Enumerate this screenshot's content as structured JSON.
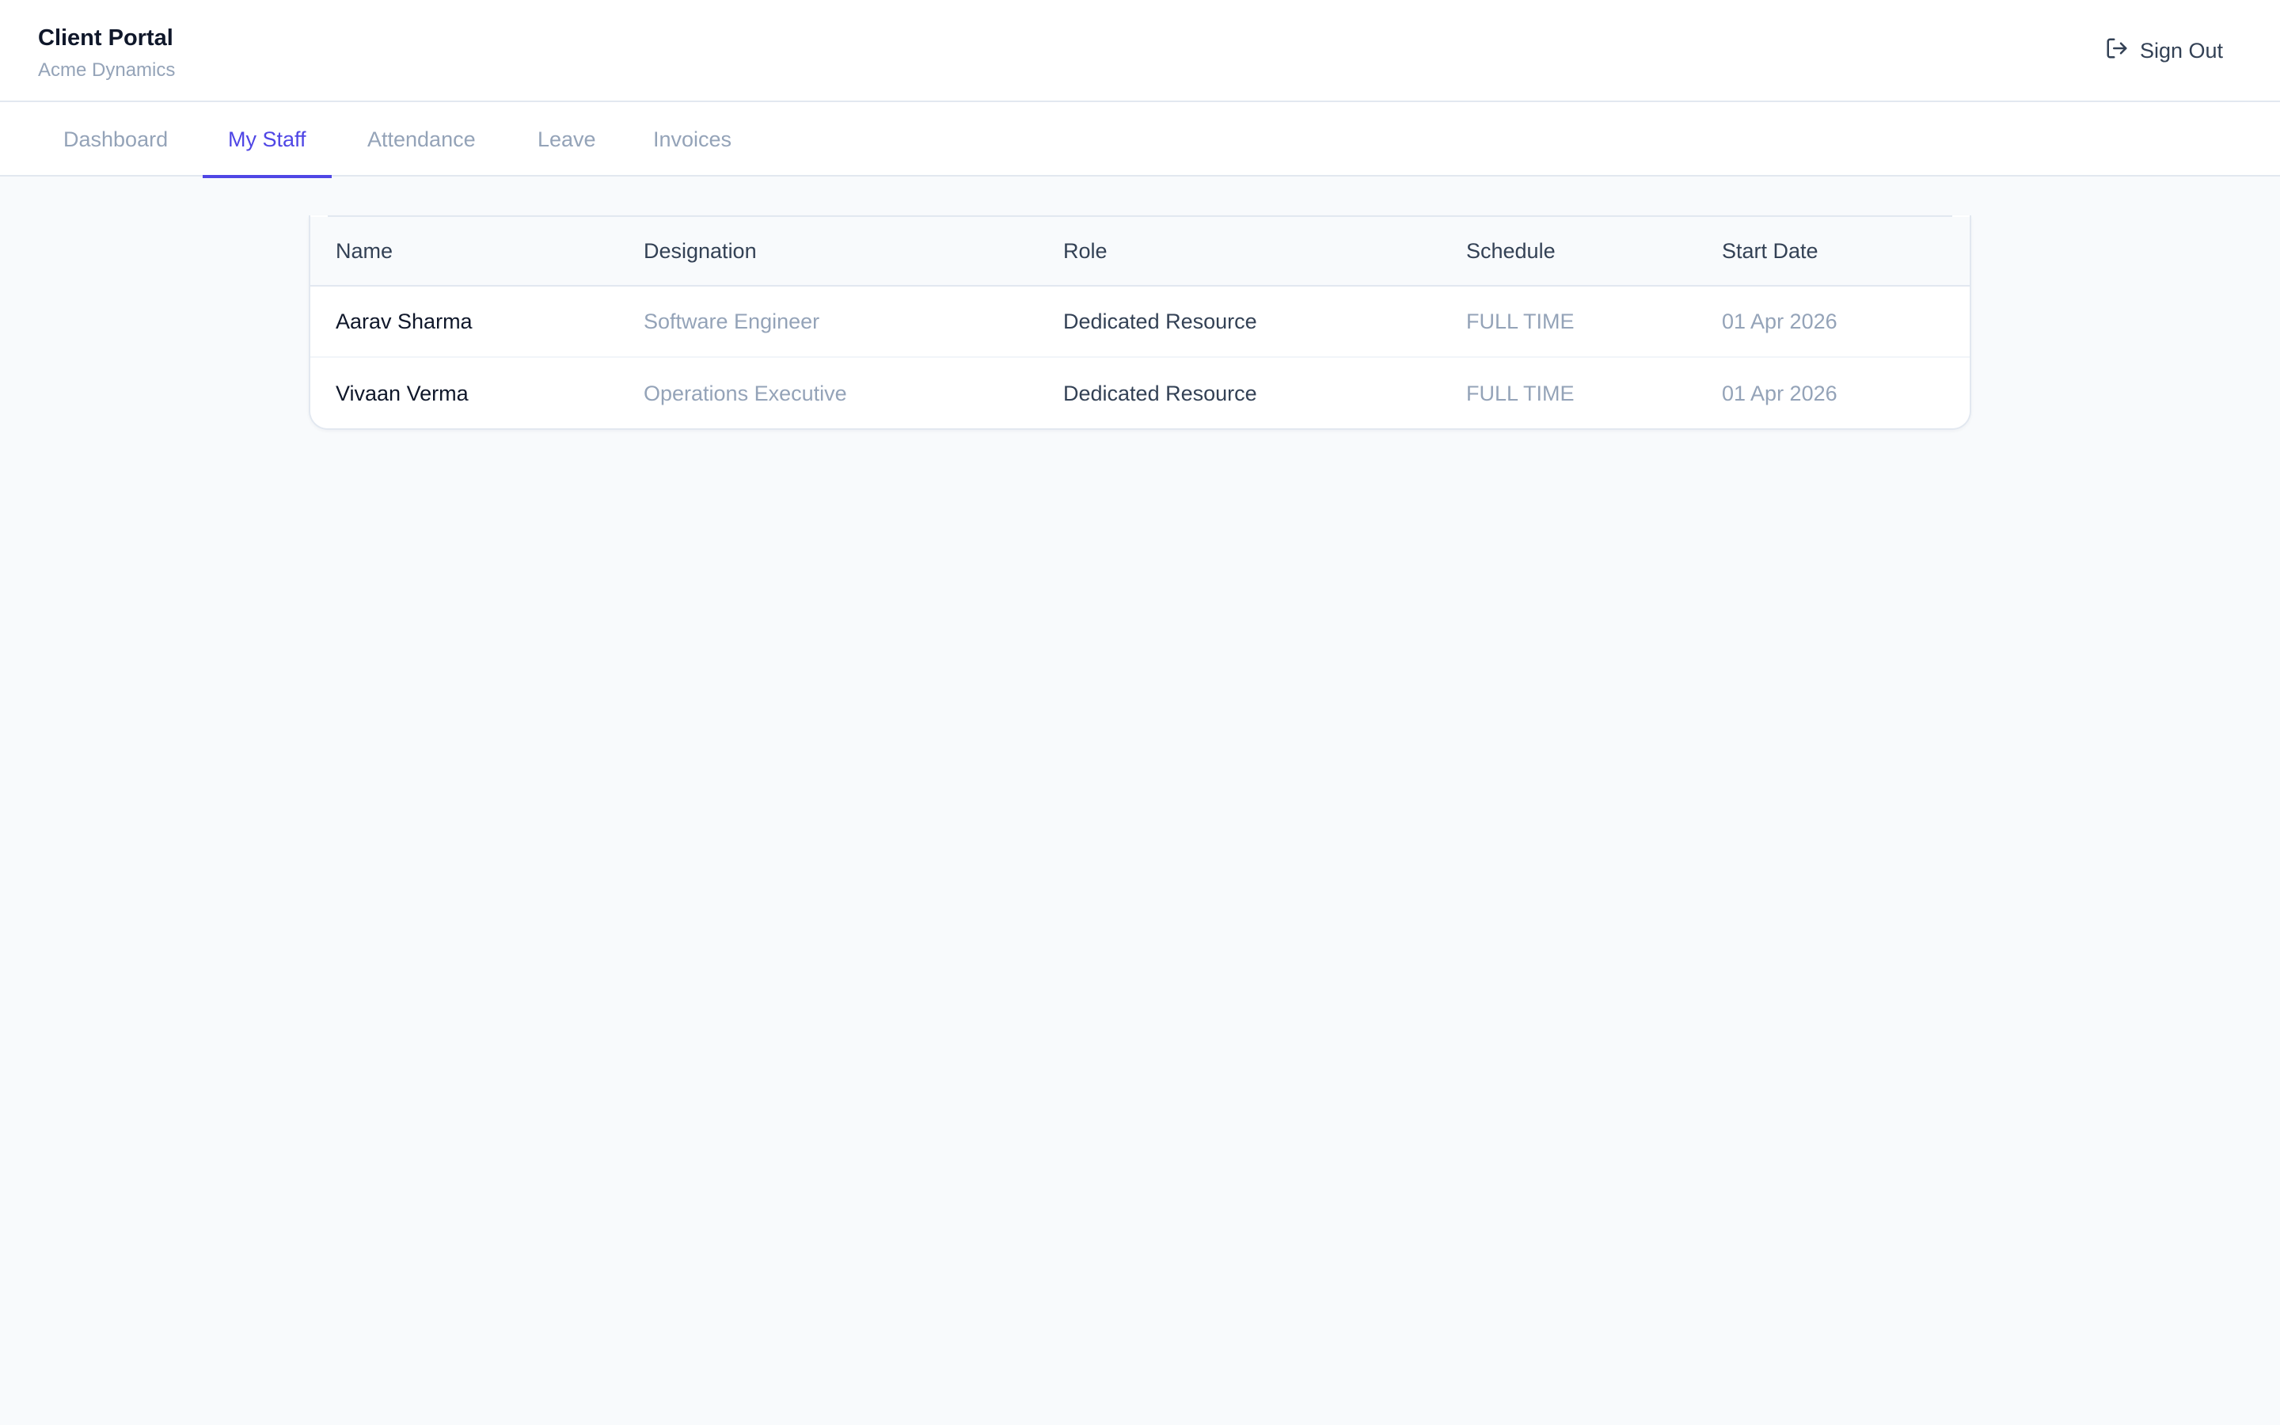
{
  "header": {
    "title": "Client Portal",
    "subtitle": "Acme Dynamics",
    "sign_out_label": "Sign Out",
    "sign_out_icon": "sign-out-icon"
  },
  "tabs": [
    {
      "label": "Dashboard",
      "active": false
    },
    {
      "label": "My Staff",
      "active": true
    },
    {
      "label": "Attendance",
      "active": false
    },
    {
      "label": "Leave",
      "active": false
    },
    {
      "label": "Invoices",
      "active": false
    }
  ],
  "table": {
    "columns": [
      "Name",
      "Designation",
      "Role",
      "Schedule",
      "Start Date"
    ],
    "rows": [
      {
        "name": "Aarav Sharma",
        "designation": "Software Engineer",
        "role": "Dedicated Resource",
        "schedule": "FULL TIME",
        "start_date": "01 Apr 2026"
      },
      {
        "name": "Vivaan Verma",
        "designation": "Operations Executive",
        "role": "Dedicated Resource",
        "schedule": "FULL TIME",
        "start_date": "01 Apr 2026"
      }
    ]
  },
  "colors": {
    "accent": "#4f46e5",
    "background": "#f8fafc",
    "muted_text": "#94a3b8"
  }
}
